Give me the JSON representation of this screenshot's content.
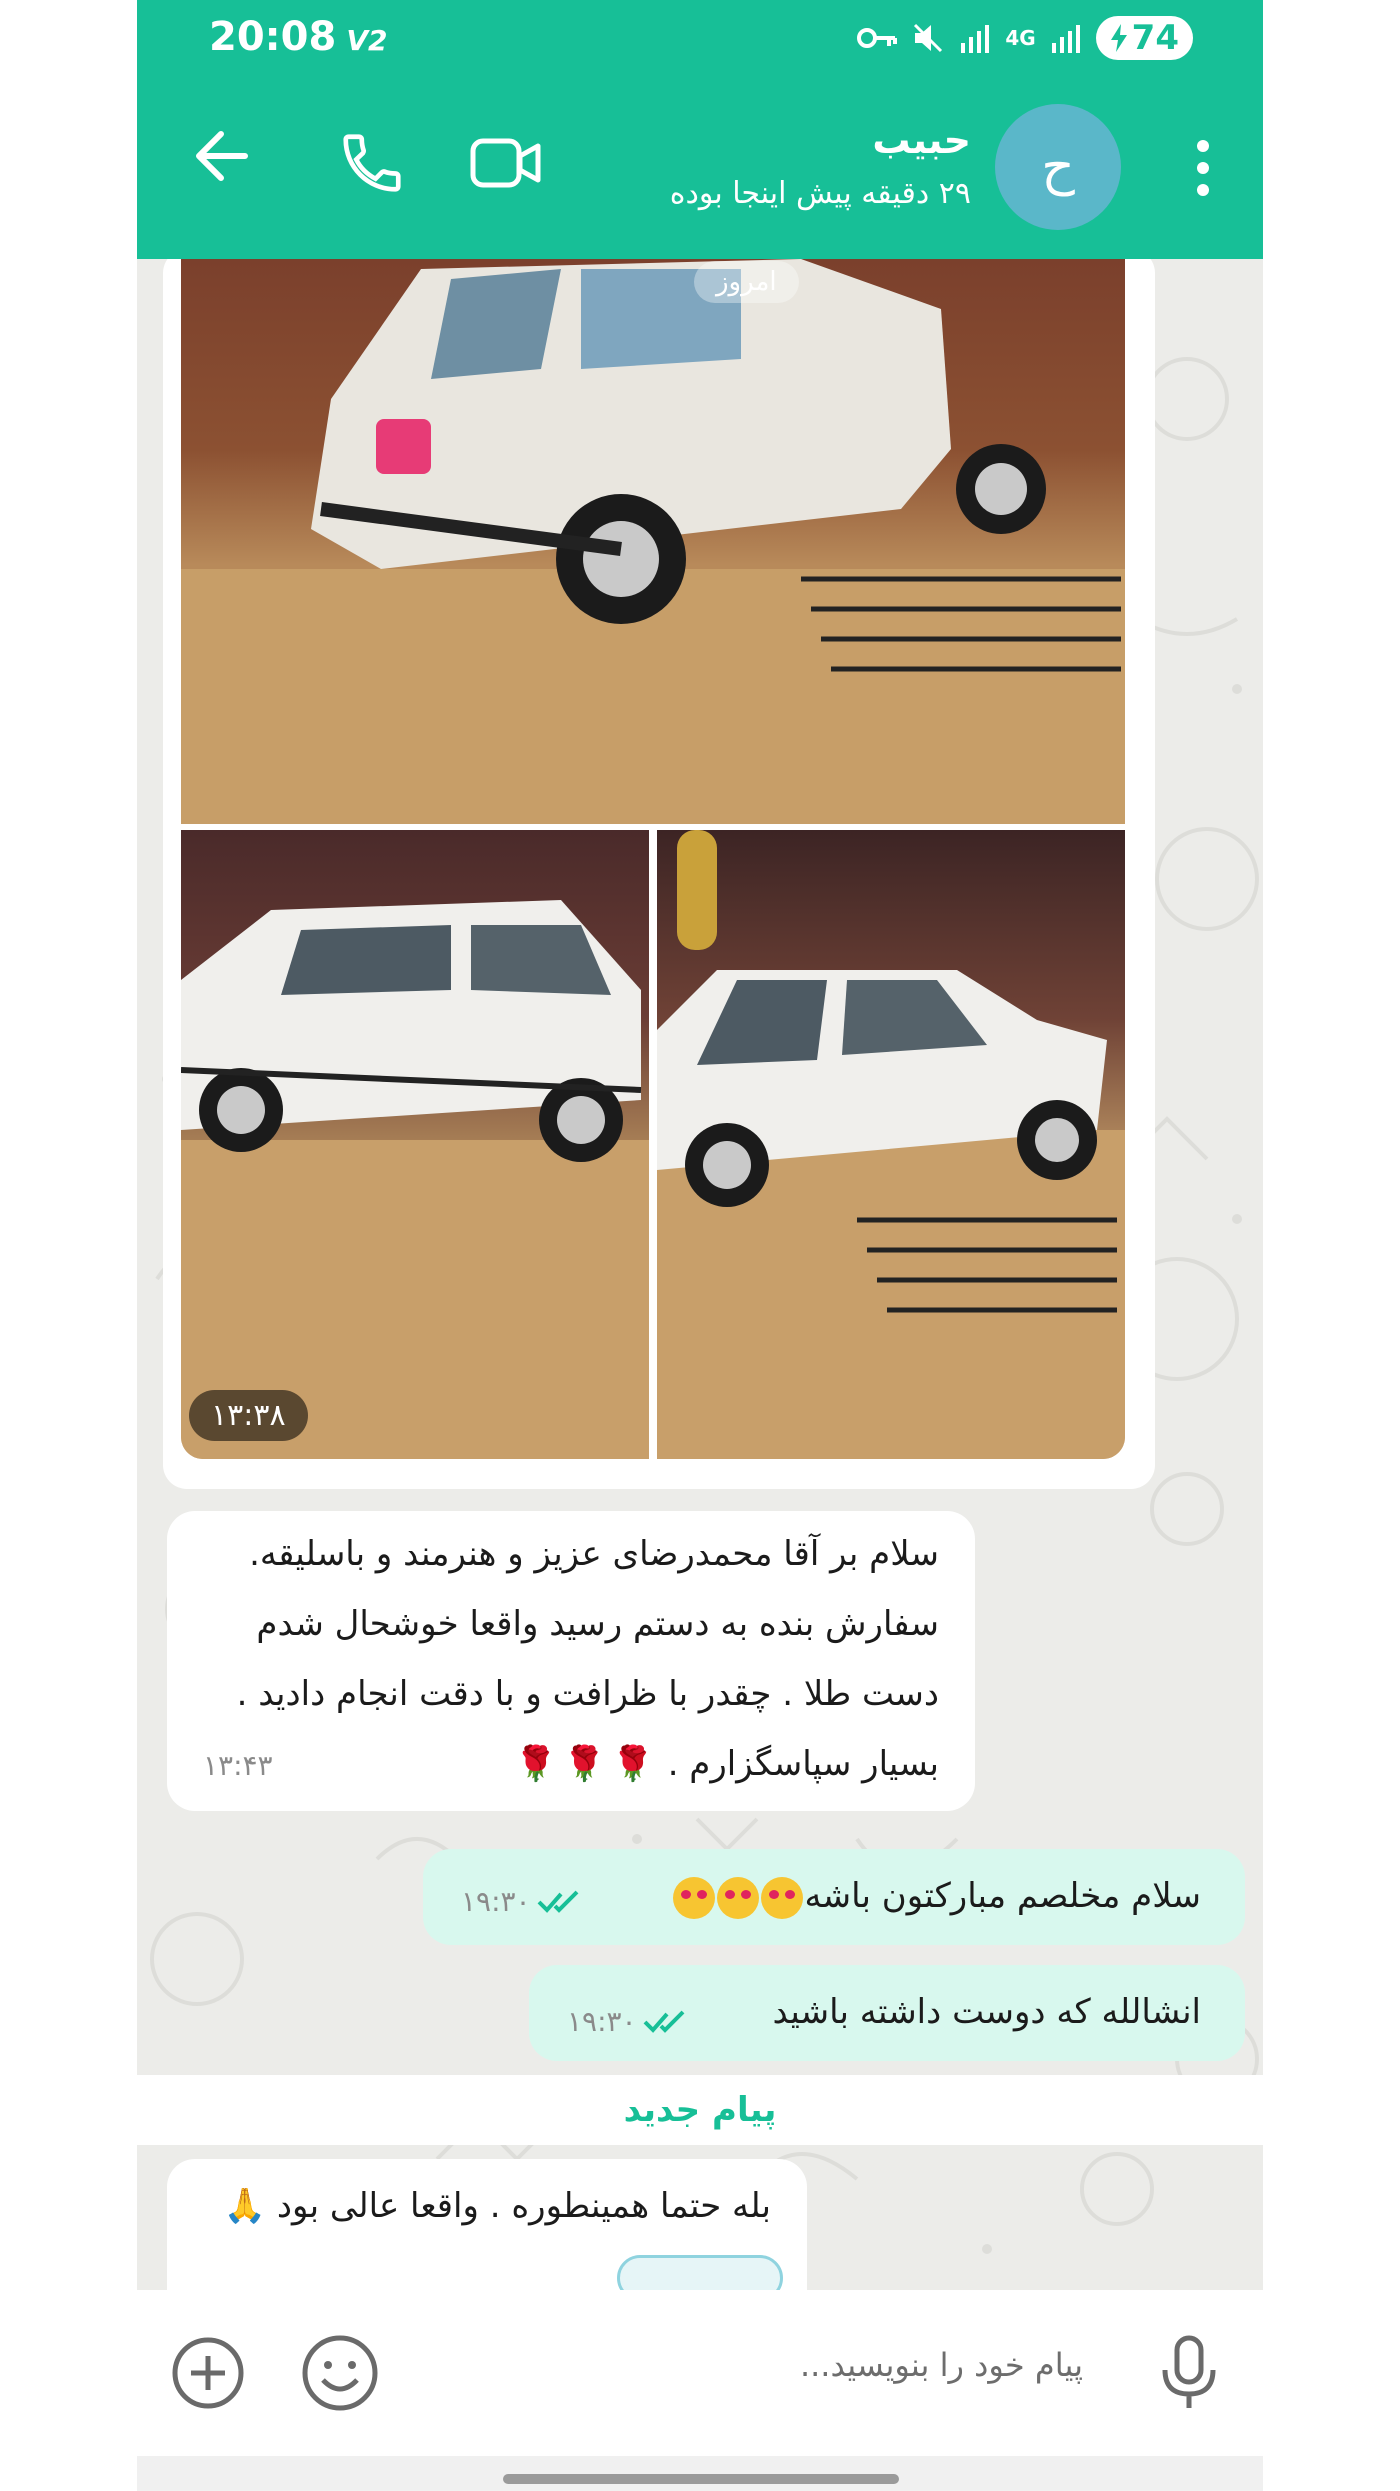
{
  "status_bar": {
    "time": "20:08",
    "carrier_tag": "V2",
    "network": "4G",
    "battery": "74"
  },
  "header": {
    "avatar_letter": "ح",
    "name": "حبیب",
    "status": "۲۹ دقیقه پیش اینجا بوده"
  },
  "chat": {
    "date_chip": "امروز",
    "photo_time": "۱۳:۳۸",
    "messages": [
      {
        "dir": "in",
        "lines": [
          "سلام بر آقا محمدرضای عزیز و هنرمند و باسلیقه.",
          "سفارش بنده به دستم رسید واقعا خوشحال شدم",
          "دست طلا . چقدر با ظرافت و با دقت انجام دادید .",
          "بسیار سپاسگزارم ."
        ],
        "time": "۱۳:۴۳"
      },
      {
        "dir": "out",
        "text": "سلام مخلصم مبارکتون باشه",
        "time": "۱۹:۳۰"
      },
      {
        "dir": "out",
        "text": "انشالله که دوست داشته باشید",
        "time": "۱۹:۳۰"
      },
      {
        "dir": "in",
        "text": "بله حتما همینطوره . واقعا عالی بود 🙏"
      }
    ],
    "new_messages_label": "پیام جدید"
  },
  "composer": {
    "placeholder": "پیام خود را بنویسید..."
  }
}
